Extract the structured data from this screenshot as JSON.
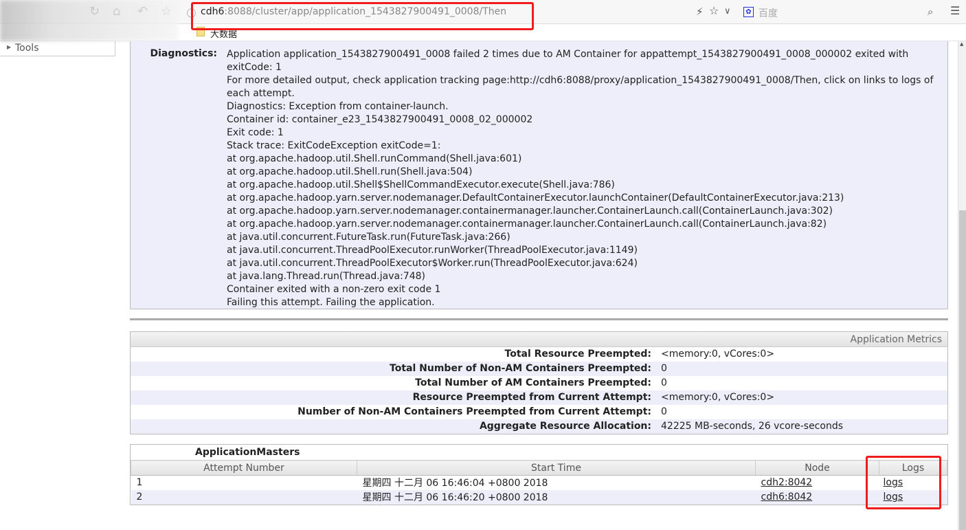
{
  "browser": {
    "url_host": "cdh6",
    "url_rest": ":8088/cluster/app/application_1543827900491_0008/Then",
    "search_engine": "百度",
    "bookmark": "大数据",
    "icons": [
      "back-icon",
      "forward-icon",
      "reload-icon",
      "home-icon",
      "undo-icon",
      "star-icon",
      "info-icon",
      "lightning-icon",
      "star-icon",
      "chevron-down-icon",
      "baidu-icon",
      "search-icon",
      "menu-icon"
    ]
  },
  "sidebar": {
    "tools": "Tools"
  },
  "diagnostics": {
    "label": "Diagnostics:",
    "text": "Application application_1543827900491_0008 failed 2 times due to AM Container for appattempt_1543827900491_0008_000002 exited with exitCode: 1\nFor more detailed output, check application tracking page:http://cdh6:8088/proxy/application_1543827900491_0008/Then, click on links to logs of each attempt.\nDiagnostics: Exception from container-launch.\nContainer id: container_e23_1543827900491_0008_02_000002\nExit code: 1\nStack trace: ExitCodeException exitCode=1:\nat org.apache.hadoop.util.Shell.runCommand(Shell.java:601)\nat org.apache.hadoop.util.Shell.run(Shell.java:504)\nat org.apache.hadoop.util.Shell$ShellCommandExecutor.execute(Shell.java:786)\nat org.apache.hadoop.yarn.server.nodemanager.DefaultContainerExecutor.launchContainer(DefaultContainerExecutor.java:213)\nat org.apache.hadoop.yarn.server.nodemanager.containermanager.launcher.ContainerLaunch.call(ContainerLaunch.java:302)\nat org.apache.hadoop.yarn.server.nodemanager.containermanager.launcher.ContainerLaunch.call(ContainerLaunch.java:82)\nat java.util.concurrent.FutureTask.run(FutureTask.java:266)\nat java.util.concurrent.ThreadPoolExecutor.runWorker(ThreadPoolExecutor.java:1149)\nat java.util.concurrent.ThreadPoolExecutor$Worker.run(ThreadPoolExecutor.java:624)\nat java.lang.Thread.run(Thread.java:748)\nContainer exited with a non-zero exit code 1\nFailing this attempt. Failing the application."
  },
  "metrics": {
    "title": "Application Metrics",
    "rows": [
      {
        "k": "Total Resource Preempted:",
        "v": "<memory:0, vCores:0>"
      },
      {
        "k": "Total Number of Non-AM Containers Preempted:",
        "v": "0"
      },
      {
        "k": "Total Number of AM Containers Preempted:",
        "v": "0"
      },
      {
        "k": "Resource Preempted from Current Attempt:",
        "v": "<memory:0, vCores:0>"
      },
      {
        "k": "Number of Non-AM Containers Preempted from Current Attempt:",
        "v": "0"
      },
      {
        "k": "Aggregate Resource Allocation:",
        "v": "42225 MB-seconds, 26 vcore-seconds"
      }
    ]
  },
  "am": {
    "title": "ApplicationMasters",
    "headers": [
      "Attempt Number",
      "Start Time",
      "Node",
      "Logs"
    ],
    "rows": [
      {
        "attempt": "1",
        "start": "星期四 十二月 06 16:46:04 +0800 2018",
        "node": "cdh2:8042",
        "logs": "logs"
      },
      {
        "attempt": "2",
        "start": "星期四 十二月 06 16:46:20 +0800 2018",
        "node": "cdh6:8042",
        "logs": "logs"
      }
    ]
  },
  "annotation_color": "#f01c1c"
}
